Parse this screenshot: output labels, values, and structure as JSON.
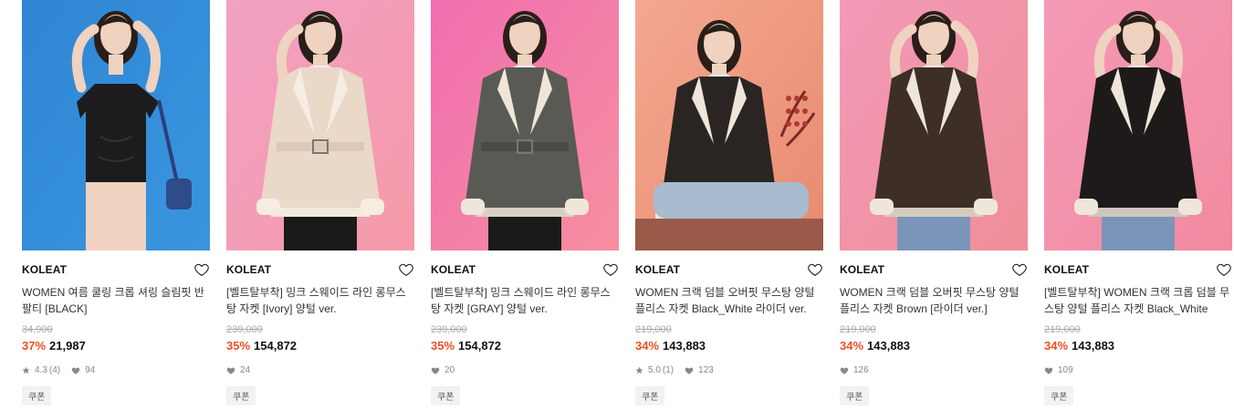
{
  "coupon_label": "쿠폰",
  "products": [
    {
      "brand": "KOLEAT",
      "title": "WOMEN 여름 쿨링 크롭 셔링 슬림핏 반팔티 [BLACK]",
      "original_price": "34,900",
      "discount": "37%",
      "price": "21,987",
      "rating": "4.3",
      "review_count": "(4)",
      "likes": "94",
      "image": {
        "bg_top": "#2f86d4",
        "bg_bottom": "#3a95de",
        "garment": "#1c1c1e",
        "desc": "model in black cropped tee on blue background"
      }
    },
    {
      "brand": "KOLEAT",
      "title": "[벨트탈부착] 밍크 스웨이드 라인 롱무스탕 자켓 [Ivory] 양털 ver.",
      "original_price": "239,000",
      "discount": "35%",
      "price": "154,872",
      "likes": "24",
      "image": {
        "bg_top": "#f2a0c4",
        "bg_bottom": "#f59aa8",
        "garment": "#ead8c8",
        "desc": "model in ivory suede belted jacket on pink background"
      }
    },
    {
      "brand": "KOLEAT",
      "title": "[벨트탈부착] 밍크 스웨이드 라인 롱무스탕 자켓 [GRAY] 양털 ver.",
      "original_price": "239,000",
      "discount": "35%",
      "price": "154,872",
      "likes": "20",
      "image": {
        "bg_top": "#f06eb0",
        "bg_bottom": "#f68fa0",
        "garment": "#5a5a55",
        "desc": "model in gray suede belted jacket on pink background"
      }
    },
    {
      "brand": "KOLEAT",
      "title": "WOMEN 크랙 덤블 오버핏 무스탕 양털 플리스 자켓 Black_White 라이더 ver.",
      "original_price": "219,000",
      "discount": "34%",
      "price": "143,883",
      "rating": "5.0",
      "review_count": "(1)",
      "likes": "123",
      "image": {
        "bg_top": "#f4a890",
        "bg_bottom": "#e88a70",
        "garment": "#2a2522",
        "desc": "seated model in black shearling rider jacket with dried flowers"
      }
    },
    {
      "brand": "KOLEAT",
      "title": "WOMEN 크랙 덤블 오버핏 무스탕 양털 플리스 자켓 Brown [라이더 ver.]",
      "original_price": "219,000",
      "discount": "34%",
      "price": "143,883",
      "likes": "126",
      "image": {
        "bg_top": "#f29ab8",
        "bg_bottom": "#f08e98",
        "garment": "#3d2f26",
        "desc": "model in brown shearling rider jacket on pink background"
      }
    },
    {
      "brand": "KOLEAT",
      "title": "[벨트탈부착] WOMEN 크랙 크롭 덤블 무스탕 양털 플리스 자켓 Black_White",
      "original_price": "219,000",
      "discount": "34%",
      "price": "143,883",
      "likes": "109",
      "image": {
        "bg_top": "#f49ab6",
        "bg_bottom": "#f28aa0",
        "garment": "#1e1a1a",
        "desc": "model in black cropped shearling jacket on pink background"
      }
    }
  ],
  "colors": {
    "discount": "#f04e23",
    "text": "#111111",
    "muted": "#888888",
    "strike": "#aaaaaa",
    "coupon_bg": "#f2f2f2"
  }
}
